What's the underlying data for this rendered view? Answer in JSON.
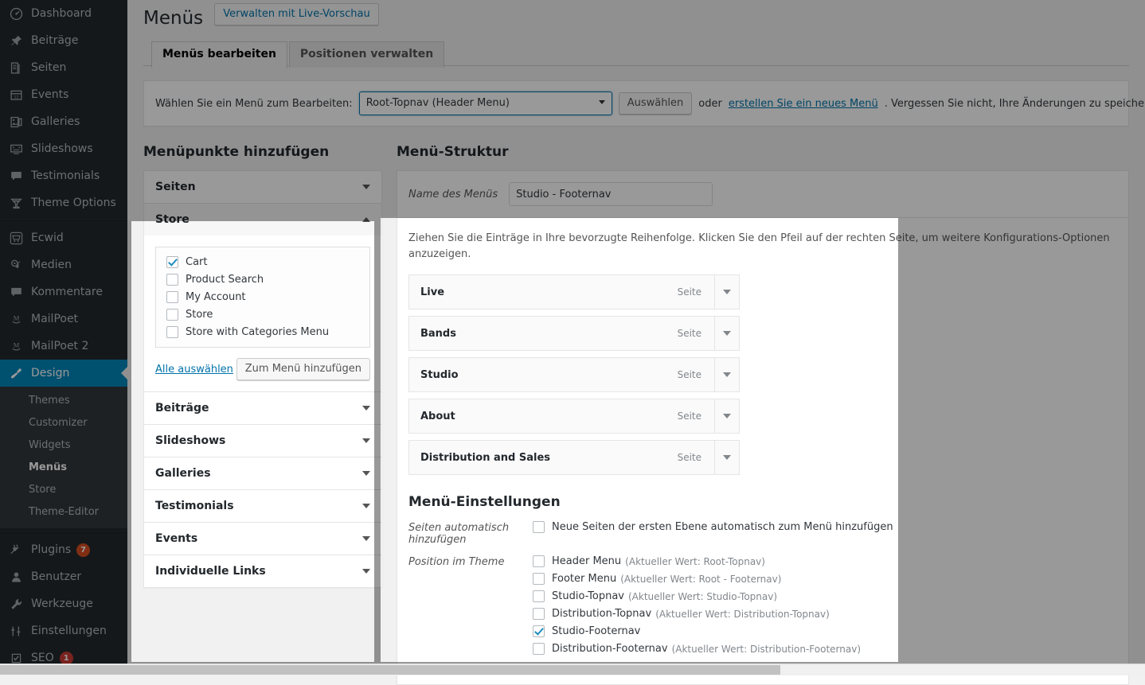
{
  "sidebar": {
    "items": [
      {
        "label": "Dashboard",
        "icon": "dashboard-icon",
        "current": false
      },
      {
        "label": "Beiträge",
        "icon": "pin-icon",
        "current": false
      },
      {
        "label": "Seiten",
        "icon": "pages-icon",
        "current": false
      },
      {
        "label": "Events",
        "icon": "calendar-icon",
        "current": false
      },
      {
        "label": "Galleries",
        "icon": "gallery-icon",
        "current": false
      },
      {
        "label": "Slideshows",
        "icon": "slideshow-icon",
        "current": false
      },
      {
        "label": "Testimonials",
        "icon": "testimonial-icon",
        "current": false
      },
      {
        "label": "Theme Options",
        "icon": "cocktail-icon",
        "current": false
      },
      {
        "label": "Ecwid",
        "icon": "cart-icon",
        "current": false
      },
      {
        "label": "Medien",
        "icon": "media-icon",
        "current": false
      },
      {
        "label": "Kommentare",
        "icon": "comments-icon",
        "current": false
      },
      {
        "label": "MailPoet",
        "icon": "mailpoet-icon",
        "current": false
      },
      {
        "label": "MailPoet 2",
        "icon": "mailpoet-icon",
        "current": false
      },
      {
        "label": "Design",
        "icon": "appearance-icon",
        "current": true
      }
    ],
    "submenu": [
      {
        "label": "Themes",
        "active": false
      },
      {
        "label": "Customizer",
        "active": false
      },
      {
        "label": "Widgets",
        "active": false
      },
      {
        "label": "Menüs",
        "active": true
      },
      {
        "label": "Store",
        "active": false
      },
      {
        "label": "Theme-Editor",
        "active": false
      }
    ],
    "items_bottom": [
      {
        "label": "Plugins",
        "icon": "plugins-icon",
        "badge": "7"
      },
      {
        "label": "Benutzer",
        "icon": "users-icon",
        "badge": ""
      },
      {
        "label": "Werkzeuge",
        "icon": "tools-icon",
        "badge": ""
      },
      {
        "label": "Einstellungen",
        "icon": "settings-icon",
        "badge": ""
      },
      {
        "label": "SEO",
        "icon": "seo-icon",
        "badge": "1"
      }
    ]
  },
  "header": {
    "title": "Menüs",
    "action_label": "Verwalten mit Live-Vorschau",
    "tabs": [
      {
        "label": "Menüs bearbeiten",
        "active": true
      },
      {
        "label": "Positionen verwalten",
        "active": false
      }
    ]
  },
  "select_bar": {
    "label": "Wählen Sie ein Menü zum Bearbeiten:",
    "selected": "Root-Topnav (Header Menu)",
    "options": [
      "Root-Topnav (Header Menu)"
    ],
    "button_label": "Auswählen",
    "or_text": "oder",
    "create_link": "erstellen Sie ein neues Menü",
    "tail_text": ". Vergessen Sie nicht, Ihre Änderungen zu speichern!"
  },
  "add_items": {
    "title": "Menüpunkte hinzufügen",
    "sections": [
      {
        "label": "Seiten",
        "open": false
      },
      {
        "label": "Store",
        "open": true
      },
      {
        "label": "Beiträge",
        "open": false
      },
      {
        "label": "Slideshows",
        "open": false
      },
      {
        "label": "Galleries",
        "open": false
      },
      {
        "label": "Testimonials",
        "open": false
      },
      {
        "label": "Events",
        "open": false
      },
      {
        "label": "Individuelle Links",
        "open": false
      }
    ],
    "store_items": [
      {
        "label": "Cart",
        "checked": true
      },
      {
        "label": "Product Search",
        "checked": false
      },
      {
        "label": "My Account",
        "checked": false
      },
      {
        "label": "Store",
        "checked": false
      },
      {
        "label": "Store with Categories Menu",
        "checked": false
      }
    ],
    "select_all_label": "Alle auswählen",
    "add_button_label": "Zum Menü hinzufügen"
  },
  "structure": {
    "title": "Menü-Struktur",
    "name_label": "Name des Menüs",
    "name_value": "Studio - Footernav",
    "drag_hint": "Ziehen Sie die Einträge in Ihre bevorzugte Reihenfolge. Klicken Sie den Pfeil auf der rechten Seite, um weitere Konfigurations-Optionen anzuzeigen.",
    "items": [
      {
        "title": "Live",
        "type": "Seite"
      },
      {
        "title": "Bands",
        "type": "Seite"
      },
      {
        "title": "Studio",
        "type": "Seite"
      },
      {
        "title": "About",
        "type": "Seite"
      },
      {
        "title": "Distribution and Sales",
        "type": "Seite"
      }
    ]
  },
  "settings": {
    "title": "Menü-Einstellungen",
    "auto_add_label": "Seiten automatisch hinzufügen",
    "auto_add_option": "Neue Seiten der ersten Ebene automatisch zum Menü hinzufügen",
    "auto_add_checked": false,
    "position_label": "Position im Theme",
    "positions": [
      {
        "label": "Header Menu",
        "note": "(Aktueller Wert: Root-Topnav)",
        "checked": false
      },
      {
        "label": "Footer Menu",
        "note": "(Aktueller Wert: Root - Footernav)",
        "checked": false
      },
      {
        "label": "Studio-Topnav",
        "note": "(Aktueller Wert: Studio-Topnav)",
        "checked": false
      },
      {
        "label": "Distribution-Topnav",
        "note": "(Aktueller Wert: Distribution-Topnav)",
        "checked": false
      },
      {
        "label": "Studio-Footernav",
        "note": "",
        "checked": true
      },
      {
        "label": "Distribution-Footernav",
        "note": "(Aktueller Wert: Distribution-Footernav)",
        "checked": false
      }
    ]
  },
  "colors": {
    "accent": "#0085ba",
    "sidebar_bg": "#23282d",
    "submenu_bg": "#32373c",
    "badge": "#d54e21",
    "link": "#0073aa",
    "overlay": "rgba(0,0,0,0.40)"
  }
}
